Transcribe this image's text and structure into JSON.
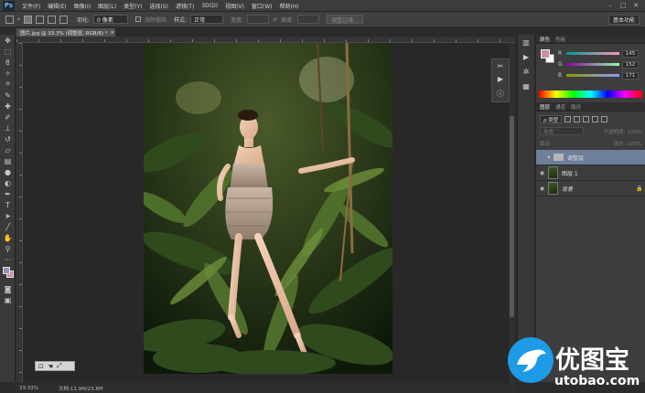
{
  "app": {
    "logo": "Ps"
  },
  "menu": [
    "文件(F)",
    "编辑(E)",
    "图像(I)",
    "图层(L)",
    "类型(Y)",
    "选择(S)",
    "滤镜(T)",
    "3D(D)",
    "视图(V)",
    "窗口(W)",
    "帮助(H)"
  ],
  "options": {
    "feather_label": "羽化:",
    "feather_value": "0 像素",
    "antialias_label": "消除锯齿",
    "style_label": "样式:",
    "style_value": "正常",
    "width_label": "宽度:",
    "height_label": "高度:",
    "refine_label": "调整边缘...",
    "workspace": "基本功能"
  },
  "document": {
    "tab_title": "图片.jpg @ 33.3% (调整层, RGB/8) *",
    "close": "×"
  },
  "status": {
    "zoom": "33.33%",
    "doc_size": "文档:11.9M/23.8M"
  },
  "color_panel": {
    "tabs": [
      "颜色",
      "色板"
    ],
    "r_label": "R",
    "r_value": "145",
    "g_label": "G",
    "g_value": "152",
    "b_label": "B",
    "b_value": "171",
    "fg_color": "#c991ab"
  },
  "layers_panel": {
    "tabs": [
      "图层",
      "通道",
      "路径"
    ],
    "filter_kind": "ρ 类型",
    "blend_mode": "穿透",
    "opacity_label": "不透明度: 100%",
    "lock_label": "锁定:",
    "fill_label": "填充: 100%",
    "layers": [
      {
        "name": "调整层",
        "type": "group",
        "selected": true
      },
      {
        "name": "图层 1",
        "type": "pixel",
        "selected": false
      },
      {
        "name": "背景",
        "type": "background",
        "selected": false
      }
    ]
  },
  "watermark": {
    "title": "优图宝",
    "url": "utobao.com"
  },
  "colors": {
    "accent": "#1d9be6",
    "selected_layer": "#6e7f9a"
  }
}
